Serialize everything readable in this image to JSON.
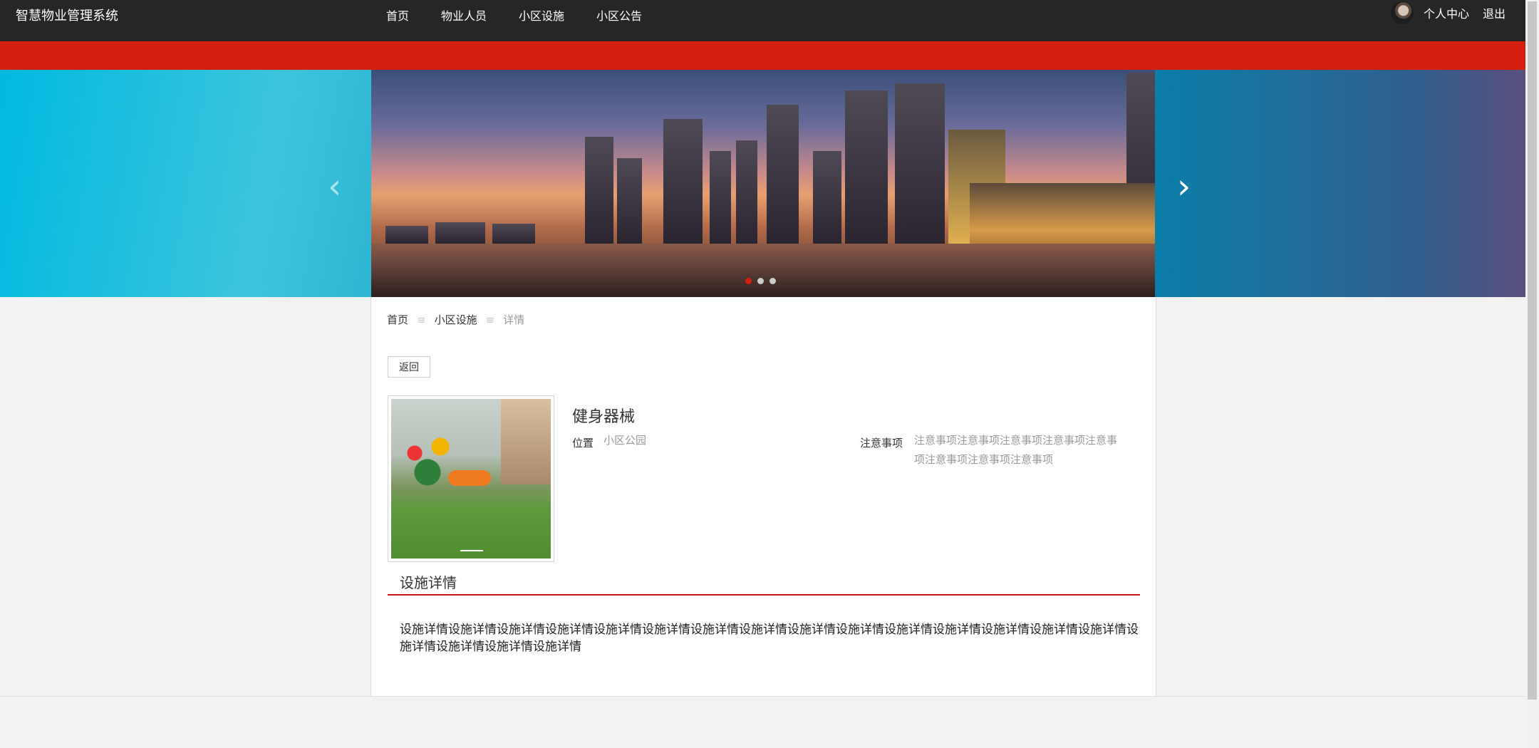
{
  "header": {
    "brand": "智慧物业管理系统",
    "nav": [
      "首页",
      "物业人员",
      "小区设施",
      "小区公告"
    ],
    "user_center": "个人中心",
    "logout": "退出"
  },
  "breadcrumb": {
    "home": "首页",
    "section": "小区设施",
    "current": "详情",
    "separator": "≡"
  },
  "back_label": "返回",
  "facility": {
    "name": "健身器械",
    "location_label": "位置",
    "location_value": "小区公园",
    "notes_label": "注意事项",
    "notes_value": "注意事项注意事项注意事项注意事项注意事项注意事项注意事项注意事项"
  },
  "details": {
    "title": "设施详情",
    "text": "设施详情设施详情设施详情设施详情设施详情设施详情设施详情设施详情设施详情设施详情设施详情设施详情设施详情设施详情设施详情设施详情设施详情设施详情设施详情"
  },
  "carousel": {
    "slide_count": 3,
    "active_index": 0
  },
  "colors": {
    "topbar": "#262626",
    "accent_red": "#d61e0e",
    "section_line": "#c8161d"
  }
}
